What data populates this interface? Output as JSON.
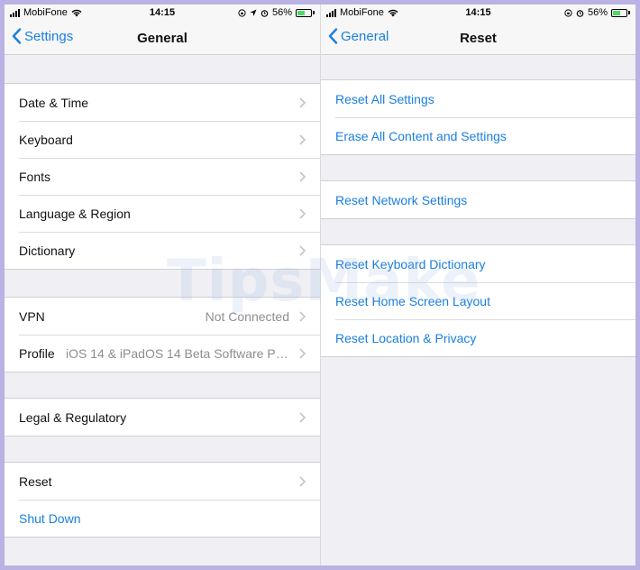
{
  "colors": {
    "accent": "#1a7fe0",
    "background": "#efeff4",
    "detail": "#8e8e93",
    "frame": "#b9b2e3"
  },
  "left": {
    "status": {
      "carrier": "MobiFone",
      "time": "14:15",
      "battery": "56%"
    },
    "nav": {
      "back_label": "Settings",
      "title": "General"
    },
    "groups": [
      {
        "items": [
          {
            "label": "Date & Time"
          },
          {
            "label": "Keyboard"
          },
          {
            "label": "Fonts"
          },
          {
            "label": "Language & Region"
          },
          {
            "label": "Dictionary"
          }
        ]
      },
      {
        "items": [
          {
            "label": "VPN",
            "detail": "Not Connected"
          },
          {
            "label": "Profile",
            "detail": "iOS 14 & iPadOS 14 Beta Software Pr..."
          }
        ]
      },
      {
        "items": [
          {
            "label": "Legal & Regulatory"
          }
        ]
      },
      {
        "items": [
          {
            "label": "Reset"
          },
          {
            "label": "Shut Down"
          }
        ]
      }
    ]
  },
  "right": {
    "status": {
      "carrier": "MobiFone",
      "time": "14:15",
      "battery": "56%"
    },
    "nav": {
      "back_label": "General",
      "title": "Reset"
    },
    "groups": [
      {
        "items": [
          {
            "label": "Reset All Settings"
          },
          {
            "label": "Erase All Content and Settings"
          }
        ]
      },
      {
        "items": [
          {
            "label": "Reset Network Settings"
          }
        ]
      },
      {
        "items": [
          {
            "label": "Reset Keyboard Dictionary"
          },
          {
            "label": "Reset Home Screen Layout"
          },
          {
            "label": "Reset Location & Privacy"
          }
        ]
      }
    ]
  },
  "watermark": "TipsMake"
}
